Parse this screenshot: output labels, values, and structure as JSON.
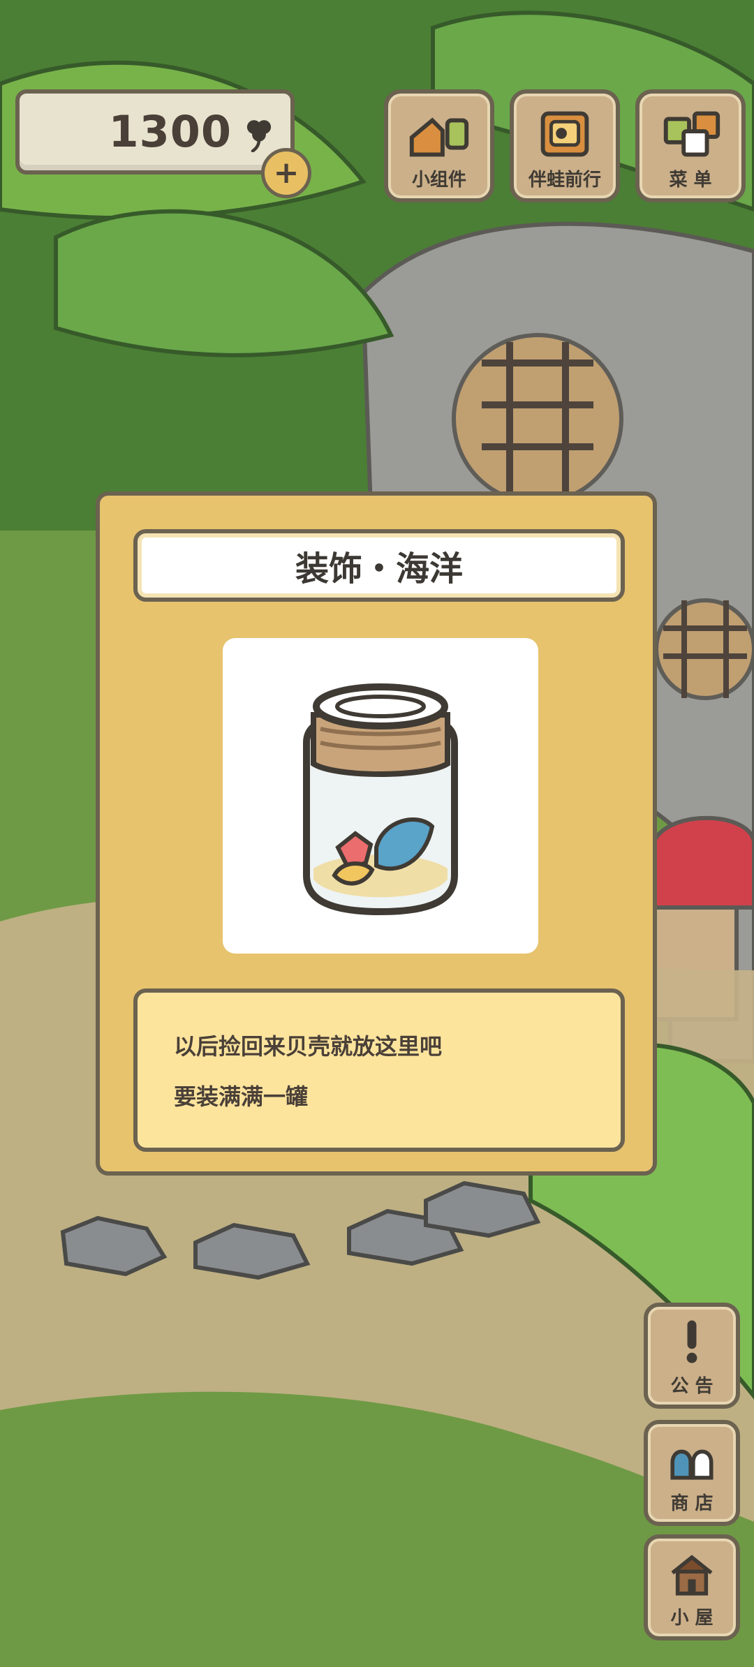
{
  "hud": {
    "currency_value": "1300",
    "add_label": "+"
  },
  "top_menu": [
    {
      "label": "小组件"
    },
    {
      "label": "伴蛙前行"
    },
    {
      "label": "菜 单"
    }
  ],
  "modal": {
    "title": "装饰・海洋",
    "item": "shell-jar",
    "description_lines": [
      "以后捡回来贝壳就放这里吧",
      "要装满满一罐"
    ]
  },
  "side_menu": [
    {
      "label": "公 告",
      "icon": "exclamation-icon"
    },
    {
      "label": "商 店",
      "icon": "bags-icon"
    },
    {
      "label": "小 屋",
      "icon": "house-icon"
    }
  ],
  "colors": {
    "panel": "#e7c36e",
    "panel_border": "#6b6250",
    "description_bg": "#fde49d",
    "button_wood": "#cbb08a"
  }
}
